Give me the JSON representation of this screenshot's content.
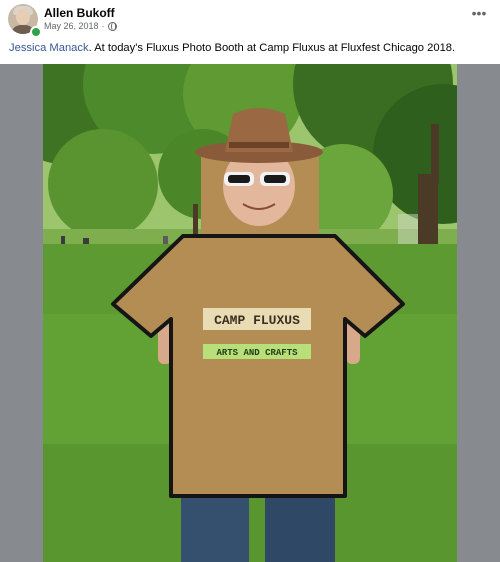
{
  "post": {
    "author": "Allen Bukoff",
    "date": "May 26, 2018",
    "separator": "·",
    "privacy_icon": "globe-icon",
    "more_icon": "more-options-icon",
    "more_label": "•••",
    "mention": "Jessica Manack",
    "text": ". At today's Fluxus Photo Booth at Camp Fluxus at Fluxfest Chicago 2018."
  },
  "photo": {
    "sign_title": "CAMP FLUXUS",
    "sign_subtitle": "ARTS AND CRAFTS"
  },
  "colors": {
    "mention": "#385898",
    "online": "#31a24c",
    "cardboard": "#b48d55",
    "grass": "#5d9a32"
  }
}
